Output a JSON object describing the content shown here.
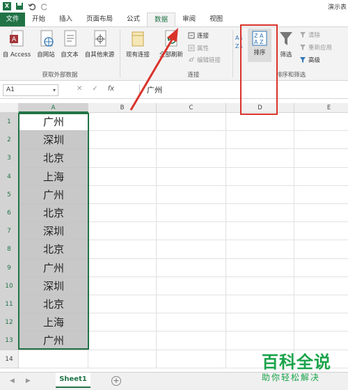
{
  "title_text": "演示表",
  "tabs": [
    "文件",
    "开始",
    "插入",
    "页面布局",
    "公式",
    "数据",
    "审阅",
    "视图"
  ],
  "ribbon": {
    "get_external": {
      "buttons": [
        "自 Access",
        "自网站",
        "自文本",
        "自其他来源",
        "现有连接"
      ],
      "label": "获取外部数据"
    },
    "connections": {
      "refresh": "全部刷新",
      "small": [
        "连接",
        "属性",
        "编辑链接"
      ],
      "label": "连接"
    },
    "sort_filter": {
      "sort": "排序",
      "filter": "筛选",
      "small": [
        "清除",
        "重新应用",
        "高级"
      ],
      "label": "排序和筛选"
    }
  },
  "formula_bar": {
    "name_box": "A1",
    "fx": "fx",
    "content": "广州"
  },
  "columns": [
    "A",
    "B",
    "C",
    "D",
    "E"
  ],
  "rows": [
    "1",
    "2",
    "3",
    "4",
    "5",
    "6",
    "7",
    "8",
    "9",
    "10",
    "11",
    "12",
    "13",
    "14"
  ],
  "cells_A": [
    "广州",
    "深圳",
    "北京",
    "上海",
    "广州",
    "北京",
    "深圳",
    "北京",
    "广州",
    "深圳",
    "北京",
    "上海",
    "广州"
  ],
  "sheet_tab": "Sheet1",
  "watermark": {
    "title": "百科全说",
    "subtitle": "助你轻松解决"
  },
  "colors": {
    "excel_green": "#217346",
    "highlight_red": "#d9322b",
    "watermark_green": "#1aa34a"
  }
}
